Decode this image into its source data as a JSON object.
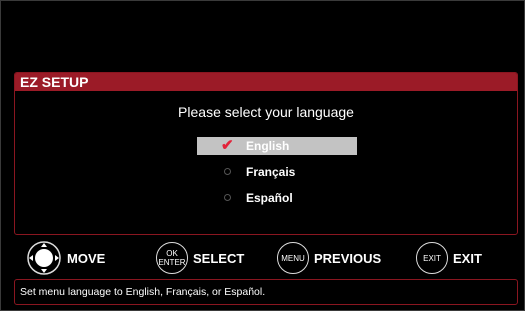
{
  "panel": {
    "title": "EZ SETUP",
    "prompt": "Please select your language"
  },
  "languages": [
    {
      "label": "English",
      "selected": true
    },
    {
      "label": "Français",
      "selected": false
    },
    {
      "label": "Español",
      "selected": false
    }
  ],
  "nav": {
    "move": {
      "label": "MOVE",
      "icon": "dpad-icon"
    },
    "select": {
      "label": "SELECT",
      "icon_line1": "OK",
      "icon_line2": "ENTER"
    },
    "previous": {
      "label": "PREVIOUS",
      "icon_text": "MENU"
    },
    "exit": {
      "label": "EXIT",
      "icon_text": "EXIT"
    }
  },
  "status": {
    "text": "Set menu language to English, Français, or Español."
  },
  "colors": {
    "accent": "#9b1b27",
    "checkmark": "#e2233a",
    "selection": "#c3c3c3"
  }
}
